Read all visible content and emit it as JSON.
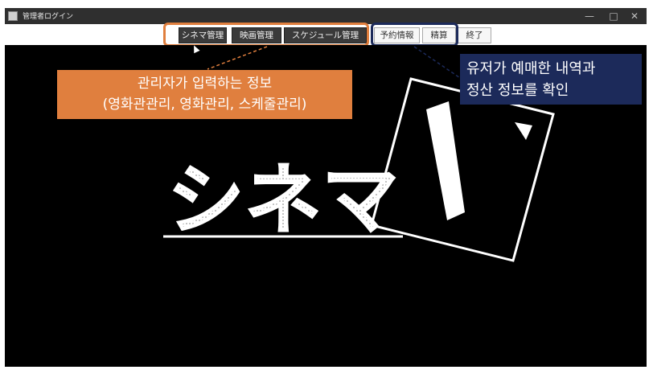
{
  "window": {
    "title": "管理者ログイン",
    "minimize_glyph": "—",
    "maximize_glyph": "□",
    "close_glyph": "✕"
  },
  "toolbar": {
    "cinema_label": "シネマ管理",
    "movie_label": "映画管理",
    "schedule_label": "スケジュール管理",
    "reserve_label": "予約情報",
    "settle_label": "精算",
    "exit_label": "終了"
  },
  "logo": {
    "text": "シネマ"
  },
  "annotations": {
    "admin_line1": "관리자가 입력하는 정보",
    "admin_line2": "(영화관관리, 영화관리, 스케줄관리)",
    "user_line1": "유저가 예매한 내역과",
    "user_line2": "정산 정보를 확인"
  },
  "colors": {
    "annotation_orange": "#e07f3e",
    "annotation_navy": "#1c2a5a",
    "canvas": "#000000"
  }
}
